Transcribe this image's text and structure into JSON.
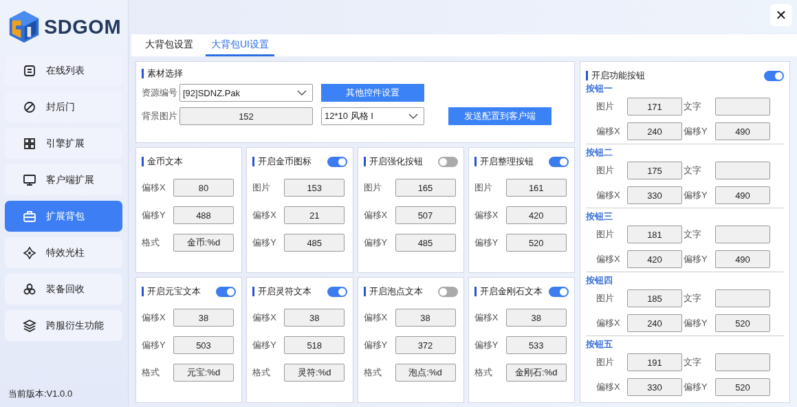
{
  "brand": {
    "name": "SDGOM"
  },
  "sidebar": {
    "items": [
      {
        "label": "在线列表",
        "selected": false
      },
      {
        "label": "封后门",
        "selected": false
      },
      {
        "label": "引擎扩展",
        "selected": false
      },
      {
        "label": "客户端扩展",
        "selected": false
      },
      {
        "label": "扩展背包",
        "selected": true
      },
      {
        "label": "特效光柱",
        "selected": false
      },
      {
        "label": "装备回收",
        "selected": false
      },
      {
        "label": "跨服衍生功能",
        "selected": false
      }
    ],
    "version": "当前版本:V1.0.0"
  },
  "close_button": "✕",
  "tabs": [
    {
      "label": "大背包设置",
      "selected": false
    },
    {
      "label": "大背包UI设置",
      "selected": true
    }
  ],
  "material": {
    "title": "素材选择",
    "resource": {
      "label": "资源编号",
      "value": "[92]SDNZ.Pak"
    },
    "other_button": "其他控件设置",
    "background": {
      "label": "背景图片",
      "value": "152"
    },
    "style": {
      "value": "12*10 风格 I"
    },
    "send_button": "发送配置到客户端"
  },
  "cards": [
    {
      "title": "金币文本",
      "fields": [
        {
          "label": "偏移X",
          "value": "80"
        },
        {
          "label": "偏移Y",
          "value": "488"
        },
        {
          "label": "格式",
          "value": "金币:%d"
        }
      ]
    },
    {
      "title": "开启金币图标",
      "on": true,
      "fields": [
        {
          "label": "图片",
          "value": "153"
        },
        {
          "label": "偏移X",
          "value": "21"
        },
        {
          "label": "偏移Y",
          "value": "485"
        }
      ]
    },
    {
      "title": "开启强化按钮",
      "on": false,
      "fields": [
        {
          "label": "图片",
          "value": "165"
        },
        {
          "label": "偏移X",
          "value": "507"
        },
        {
          "label": "偏移Y",
          "value": "485"
        }
      ]
    },
    {
      "title": "开启整理按钮",
      "on": true,
      "fields": [
        {
          "label": "图片",
          "value": "161"
        },
        {
          "label": "偏移X",
          "value": "420"
        },
        {
          "label": "偏移Y",
          "value": "520"
        }
      ]
    },
    {
      "title": "开启元宝文本",
      "on": true,
      "fields": [
        {
          "label": "偏移X",
          "value": "38"
        },
        {
          "label": "偏移Y",
          "value": "503"
        },
        {
          "label": "格式",
          "value": "元宝:%d"
        }
      ]
    },
    {
      "title": "开启灵符文本",
      "on": true,
      "fields": [
        {
          "label": "偏移X",
          "value": "38"
        },
        {
          "label": "偏移Y",
          "value": "518"
        },
        {
          "label": "格式",
          "value": "灵符:%d"
        }
      ]
    },
    {
      "title": "开启泡点文本",
      "on": false,
      "fields": [
        {
          "label": "偏移X",
          "value": "38"
        },
        {
          "label": "偏移Y",
          "value": "372"
        },
        {
          "label": "格式",
          "value": "泡点:%d"
        }
      ]
    },
    {
      "title": "开启金刚石文本",
      "on": true,
      "fields": [
        {
          "label": "偏移X",
          "value": "38"
        },
        {
          "label": "偏移Y",
          "value": "533"
        },
        {
          "label": "格式",
          "value": "金刚石:%d"
        }
      ]
    }
  ],
  "function_buttons": {
    "title": "开启功能按钮",
    "on": true,
    "groups": [
      {
        "title": "按钮一",
        "fields": [
          {
            "label": "图片",
            "value": "171"
          },
          {
            "label": "文字"
          },
          {
            "label": "偏移X",
            "value": "240"
          },
          {
            "label": "偏移Y",
            "value": "490"
          }
        ]
      },
      {
        "title": "按钮二",
        "fields": [
          {
            "label": "图片",
            "value": "175"
          },
          {
            "label": "文字"
          },
          {
            "label": "偏移X",
            "value": "330"
          },
          {
            "label": "偏移Y",
            "value": "490"
          }
        ]
      },
      {
        "title": "按钮三",
        "fields": [
          {
            "label": "图片",
            "value": "181"
          },
          {
            "label": "文字"
          },
          {
            "label": "偏移X",
            "value": "420"
          },
          {
            "label": "偏移Y",
            "value": "490"
          }
        ]
      },
      {
        "title": "按钮四",
        "fields": [
          {
            "label": "图片",
            "value": "185"
          },
          {
            "label": "文字"
          },
          {
            "label": "偏移X",
            "value": "240"
          },
          {
            "label": "偏移Y",
            "value": "520"
          }
        ]
      },
      {
        "title": "按钮五",
        "fields": [
          {
            "label": "图片",
            "value": "191"
          },
          {
            "label": "文字"
          },
          {
            "label": "偏移X",
            "value": "330"
          },
          {
            "label": "偏移Y",
            "value": "520"
          }
        ]
      }
    ]
  }
}
